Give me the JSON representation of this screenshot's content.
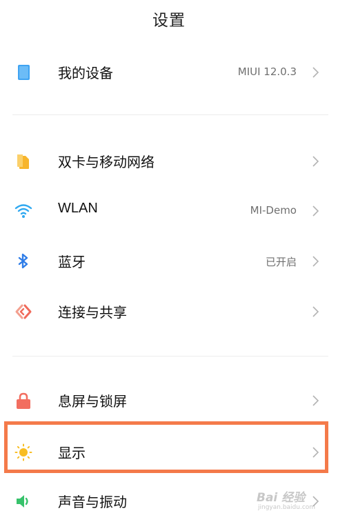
{
  "header": {
    "title": "设置"
  },
  "settings": {
    "my_device": {
      "label": "我的设备",
      "value": "MIUI 12.0.3",
      "icon": "tablet-icon",
      "color": "#3fa3f2"
    },
    "sim_network": {
      "label": "双卡与移动网络",
      "icon": "sim-card-icon",
      "color": "#f7b52c"
    },
    "wlan": {
      "label": "WLAN",
      "value": "MI-Demo",
      "icon": "wifi-icon",
      "color": "#2fa8f0"
    },
    "bluetooth": {
      "label": "蓝牙",
      "value": "已开启",
      "icon": "bluetooth-icon",
      "color": "#2f7de8"
    },
    "connection_sharing": {
      "label": "连接与共享",
      "icon": "connection-share-icon",
      "color": "#f06a5a"
    },
    "lock_screen": {
      "label": "息屏与锁屏",
      "icon": "lock-icon",
      "color": "#f26e60"
    },
    "display": {
      "label": "显示",
      "icon": "sun-icon",
      "color": "#f8bd22"
    },
    "sound_vibration": {
      "label": "声音与振动",
      "icon": "speaker-icon",
      "color": "#37c26b"
    }
  },
  "annotation": {
    "highlight_color": "#f47a4a"
  },
  "watermark": {
    "text": "Bai 经验",
    "sub": "jingyan.baidu.com"
  }
}
